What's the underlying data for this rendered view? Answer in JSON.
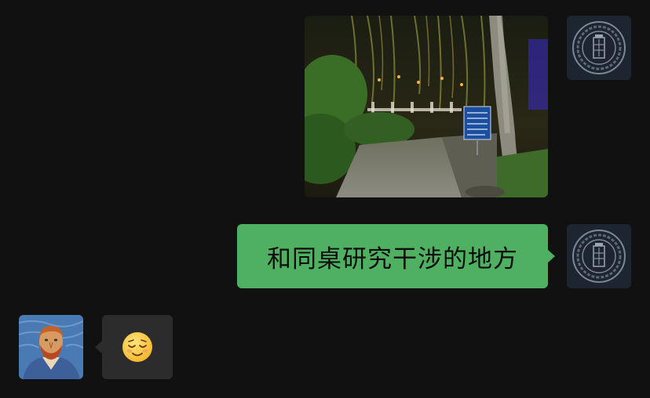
{
  "messages": [
    {
      "sender": "me",
      "type": "image",
      "avatar_icon": "tardis-seal-icon",
      "image_icon": "night-park-photo-icon"
    },
    {
      "sender": "me",
      "type": "text",
      "avatar_icon": "tardis-seal-icon",
      "text": "和同桌研究干涉的地方"
    },
    {
      "sender": "other",
      "type": "emoji",
      "avatar_icon": "van-gogh-portrait-icon",
      "emoji_icon": "relieved-face-icon"
    }
  ],
  "colors": {
    "background": "#111111",
    "my_bubble": "#4fb061",
    "other_bubble": "#2c2c2c"
  }
}
